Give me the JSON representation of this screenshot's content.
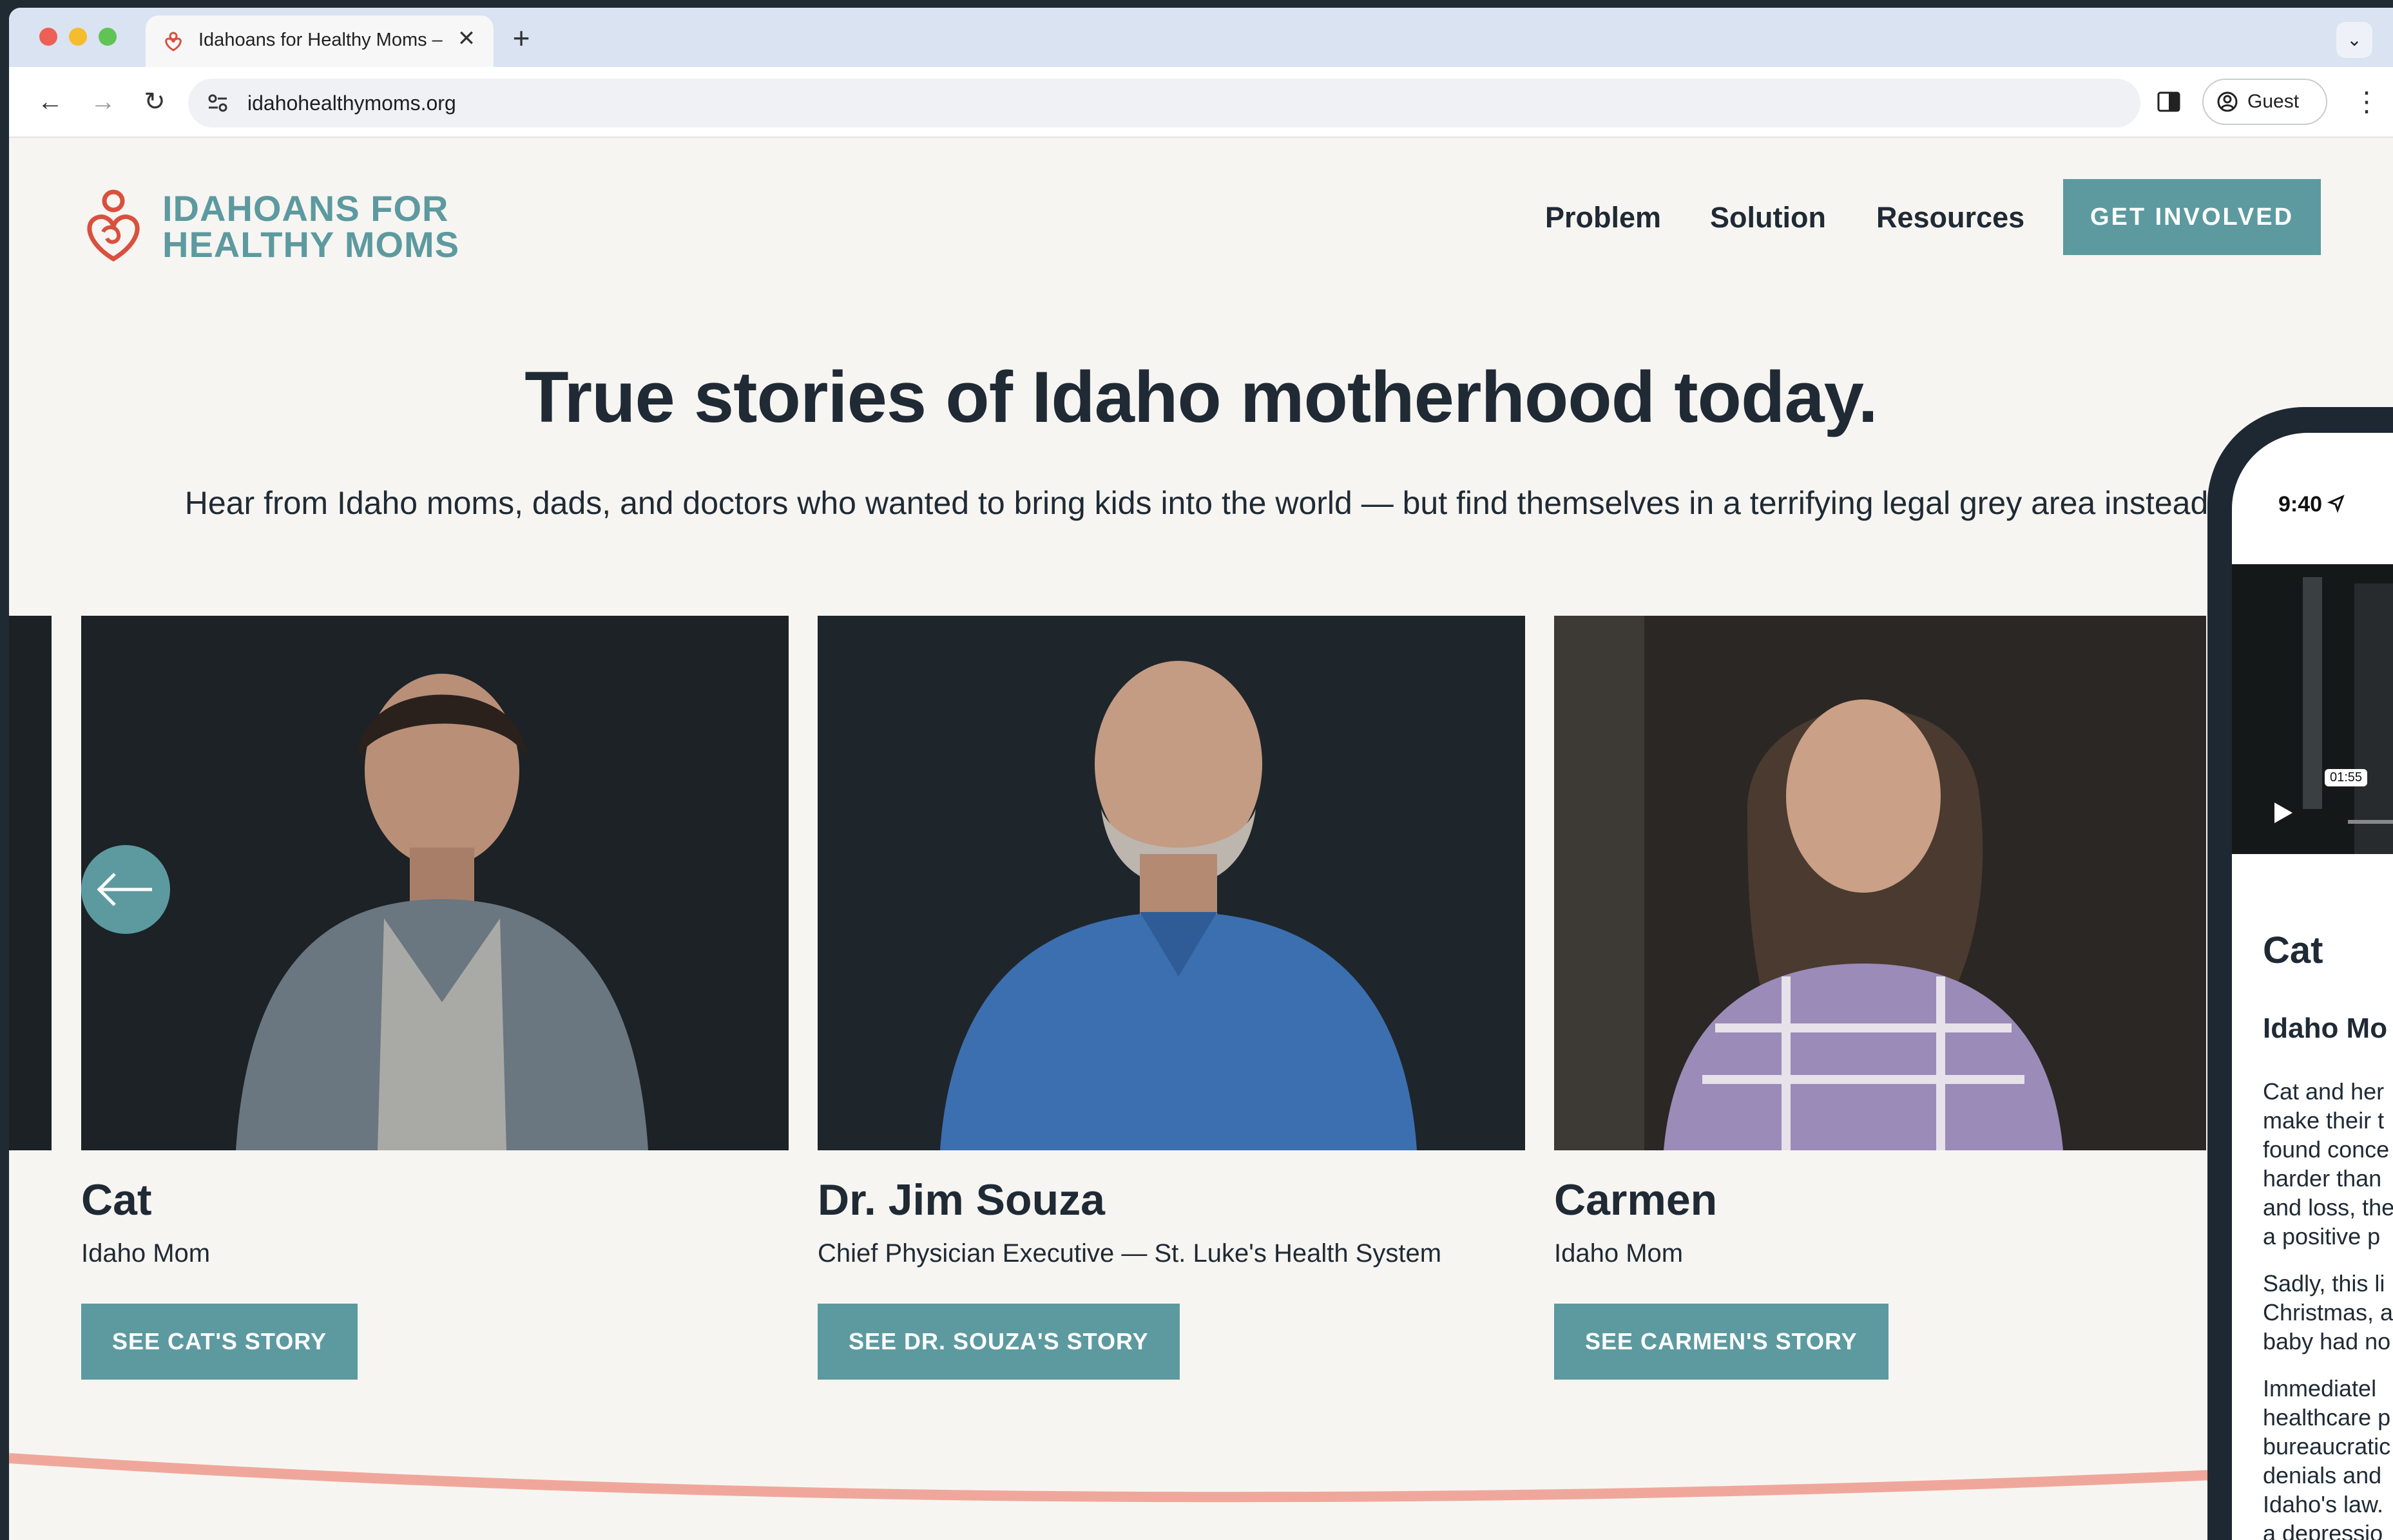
{
  "browser": {
    "tab_title": "Idahoans for Healthy Moms –",
    "tab_close": "✕",
    "new_tab": "+",
    "url": "idahohealthymoms.org",
    "profile_label": "Guest"
  },
  "site": {
    "logo_line1": "IDAHOANS FOR",
    "logo_line2": "HEALTHY MOMS",
    "nav": [
      "Problem",
      "Solution",
      "Resources"
    ],
    "cta_label": "GET INVOLVED",
    "accent_color": "#5c9aa0",
    "logo_heart_color": "#d9503f",
    "wave_color": "#f0a79b"
  },
  "hero": {
    "title": "True stories of Idaho motherhood today.",
    "subtitle": "Hear from Idaho moms, dads, and doctors who wanted to bring kids into the world — but find themselves in a terrifying legal grey area instead."
  },
  "stories": [
    {
      "name": "Cat",
      "role": "Idaho Mom",
      "button": "SEE CAT'S STORY"
    },
    {
      "name": "Dr. Jim Souza",
      "role": "Chief Physician Executive — St. Luke's Health System",
      "button": "SEE DR. SOUZA'S STORY"
    },
    {
      "name": "Carmen",
      "role": "Idaho Mom",
      "button": "SEE CARMEN'S STORY"
    }
  ],
  "phone": {
    "time": "9:40",
    "video_duration": "01:55",
    "name": "Cat",
    "role": "Idaho Mo",
    "paragraphs": [
      [
        "Cat and her",
        "make their t",
        "found conce",
        "harder than",
        "and loss, the",
        "a positive p"
      ],
      [
        "Sadly, this li",
        "Christmas, a",
        "baby had no"
      ],
      [
        "Immediatel",
        "healthcare p",
        "bureaucratic",
        "denials and",
        "Idaho's law.",
        "a depressio"
      ]
    ]
  }
}
